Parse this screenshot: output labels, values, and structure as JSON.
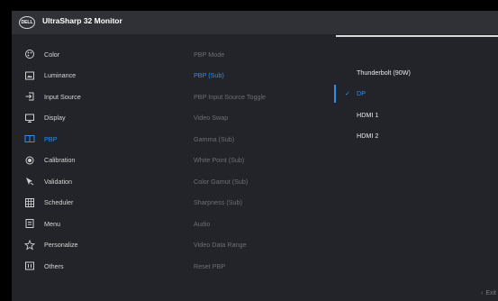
{
  "header": {
    "logo_text": "DELL",
    "title": "UltraSharp 32 Monitor"
  },
  "main_menu": [
    {
      "label": "Color",
      "icon": "color-icon",
      "active": false
    },
    {
      "label": "Luminance",
      "icon": "luminance-icon",
      "active": false
    },
    {
      "label": "Input Source",
      "icon": "input-source-icon",
      "active": false
    },
    {
      "label": "Display",
      "icon": "display-icon",
      "active": false
    },
    {
      "label": "PBP",
      "icon": "pbp-icon",
      "active": true
    },
    {
      "label": "Calibration",
      "icon": "calibration-icon",
      "active": false
    },
    {
      "label": "Validation",
      "icon": "validation-icon",
      "active": false
    },
    {
      "label": "Scheduler",
      "icon": "scheduler-icon",
      "active": false
    },
    {
      "label": "Menu",
      "icon": "menu-icon",
      "active": false
    },
    {
      "label": "Personalize",
      "icon": "star-icon",
      "active": false
    },
    {
      "label": "Others",
      "icon": "others-icon",
      "active": false
    }
  ],
  "sub_menu": [
    {
      "label": "PBP Mode",
      "active": false
    },
    {
      "label": "PBP (Sub)",
      "active": true
    },
    {
      "label": "PBP Input Source Toggle",
      "active": false
    },
    {
      "label": "Video Swap",
      "active": false
    },
    {
      "label": "Gamma (Sub)",
      "active": false
    },
    {
      "label": "White Point (Sub)",
      "active": false
    },
    {
      "label": "Color Gamut (Sub)",
      "active": false
    },
    {
      "label": "Sharpness (Sub)",
      "active": false
    },
    {
      "label": "Audio",
      "active": false
    },
    {
      "label": "Video Data Range",
      "active": false
    },
    {
      "label": "Reset PBP",
      "active": false
    }
  ],
  "options": [
    {
      "label": "Thunderbolt (90W)",
      "selected": false
    },
    {
      "label": "DP",
      "selected": true
    },
    {
      "label": "HDMI 1",
      "selected": false
    },
    {
      "label": "HDMI 2",
      "selected": false
    }
  ],
  "footer": {
    "exit_label": "Exit",
    "exit_icon": "chevron-left-icon"
  },
  "colors": {
    "accent": "#2e8ef0",
    "panel": "#222429",
    "header": "#2f3136"
  }
}
